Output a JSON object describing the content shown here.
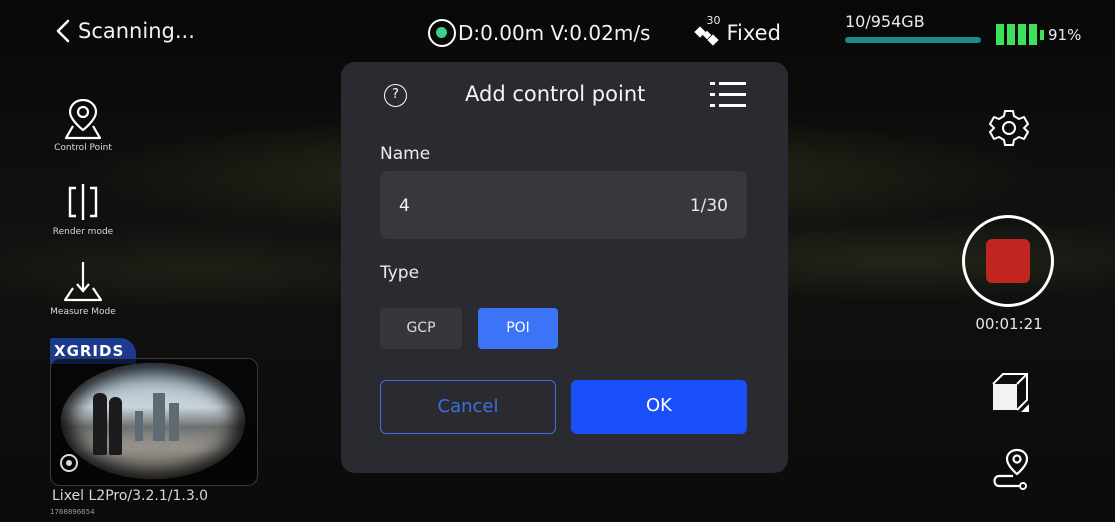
{
  "topbar": {
    "back_label": "Scanning...",
    "gps_status": "D:0.00m V:0.02m/s",
    "satellite_count": "30",
    "fix_status": "Fixed",
    "storage": "10/954GB",
    "battery": "91%"
  },
  "toolbar": {
    "control_point": "Control Point",
    "render_mode": "Render mode",
    "measure_mode": "Measure Mode"
  },
  "preview": {
    "brand": "XGRIDS",
    "device": "Lixel L2Pro/3.2.1/1.3.0",
    "serial": "1768896654"
  },
  "recording": {
    "timer": "00:01:21"
  },
  "dialog": {
    "help_glyph": "?",
    "title": "Add control point",
    "name_label": "Name",
    "name_value": "4",
    "name_counter": "1/30",
    "type_label": "Type",
    "type_options": [
      "GCP",
      "POI"
    ],
    "selected_type": "POI",
    "cancel_label": "Cancel",
    "ok_label": "OK"
  },
  "colors": {
    "accent": "#1a4ffa",
    "selected_option": "#3b74f7",
    "record": "#c0261f",
    "battery": "#3be25a",
    "gps_dot": "#3fd08e"
  },
  "icons": [
    "back-chevron-icon",
    "gps-icon",
    "satellite-icon",
    "battery-icon",
    "control-point-icon",
    "render-mode-icon",
    "measure-mode-icon",
    "camera-switch-icon",
    "settings-gear-icon",
    "record-stop-icon",
    "cube-view-icon",
    "route-icon",
    "help-icon",
    "list-icon"
  ]
}
